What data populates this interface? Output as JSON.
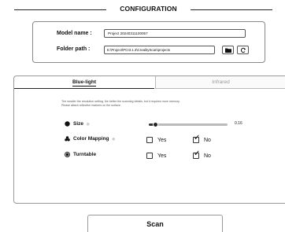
{
  "header": {
    "title": "CONFIGURATION"
  },
  "project": {
    "name_label": "Model name :",
    "name_value": "Project 20240311100057",
    "path_label": "Folder path :",
    "path_value": "E:\\Project\\PCI3.1.3\\CrealityScan\\projects",
    "folder_icon": "folder-icon",
    "refresh_icon": "refresh-icon"
  },
  "tabs": [
    {
      "label": "Blue-light",
      "active": true
    },
    {
      "label": "Infrared",
      "active": false
    }
  ],
  "hint": {
    "line1": "The smaller the resolution setting, the better the scanning details, but it requires more memory.",
    "line2": "Please attach reflective markers on the surface."
  },
  "settings": {
    "size": {
      "label": "Size",
      "value": "0.16",
      "fraction": 0.08
    },
    "color_mapping": {
      "label": "Color Mapping",
      "yes": "Yes",
      "no": "No",
      "selected": "No"
    },
    "turntable": {
      "label": "Turntable",
      "yes": "Yes",
      "no": "No",
      "selected": "No"
    }
  },
  "scan_button": {
    "label": "Scan"
  }
}
